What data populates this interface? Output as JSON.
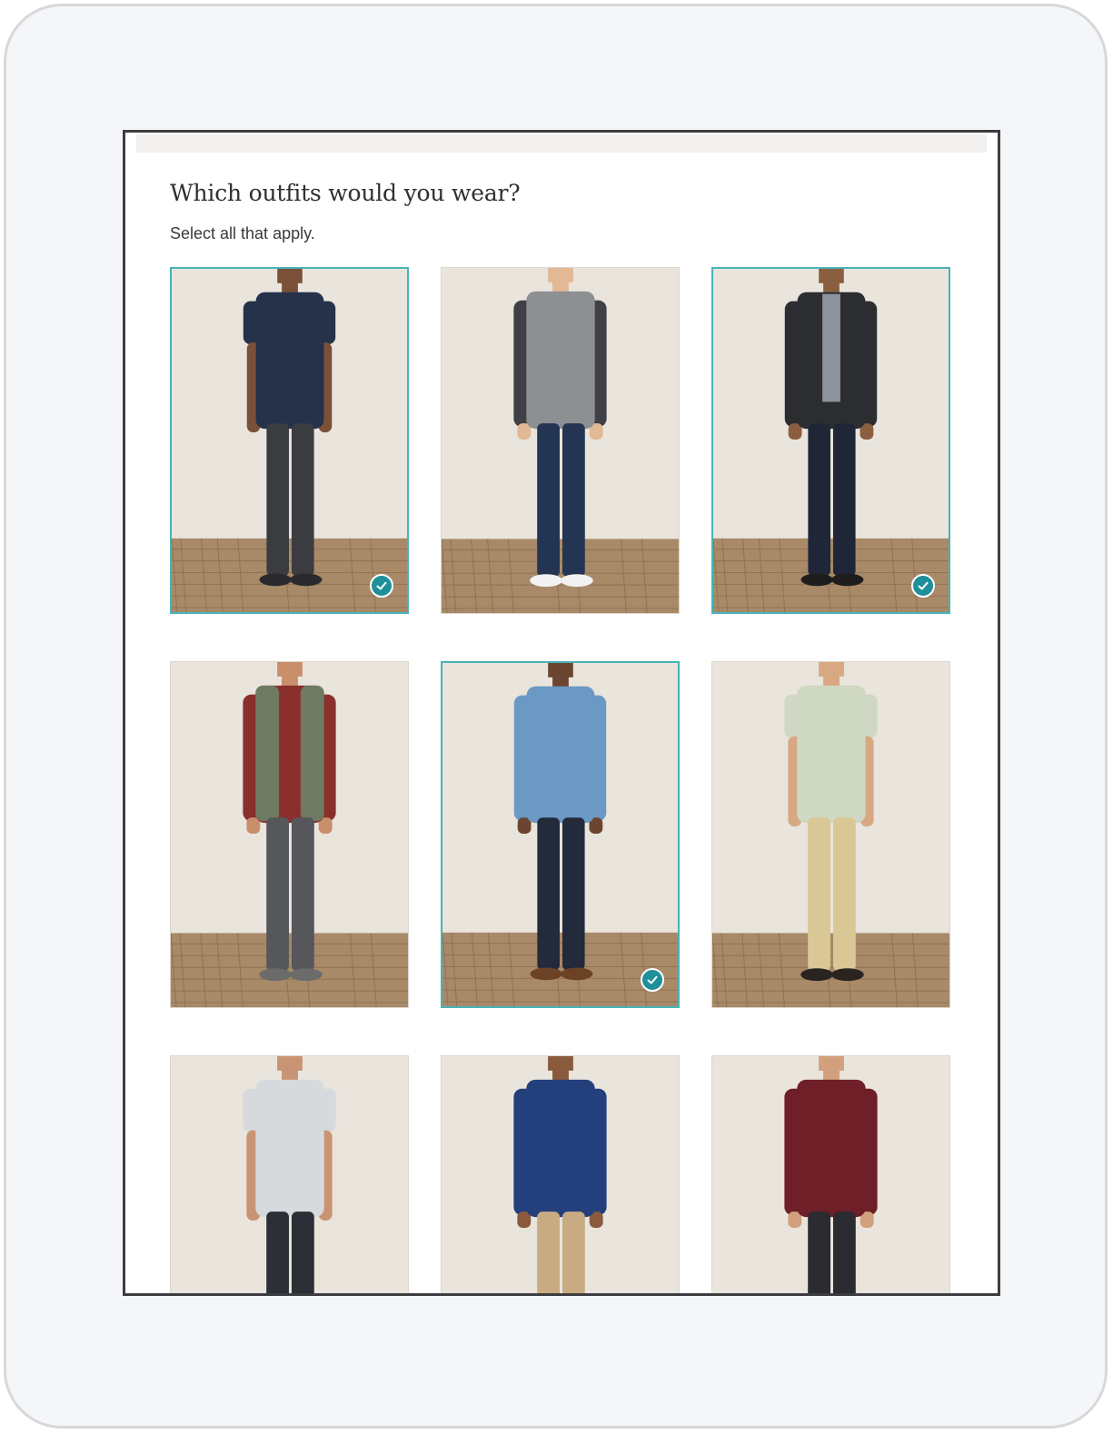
{
  "question": {
    "title": "Which outfits would you wear?",
    "subtitle": "Select all that apply."
  },
  "colors": {
    "accent": "#1f8f9a",
    "selected_border": "#47b3b8",
    "backdrop": "#e9e4dc",
    "floor": "#a88a68"
  },
  "outfits": [
    {
      "id": "outfit-1",
      "selected": true,
      "skin": "#7a5138",
      "top": "#25324a",
      "sleeves": "short",
      "bottom": "#3a3c40",
      "shoe": "#2a2a2e"
    },
    {
      "id": "outfit-2",
      "selected": false,
      "skin": "#e2b895",
      "top": "#8d8f92",
      "sleeves": "long",
      "sleeve": "#3e4045",
      "bottom": "#243553",
      "shoe": "#f2f2f2"
    },
    {
      "id": "outfit-3",
      "selected": true,
      "skin": "#8b5e3f",
      "top": "#2b2d31",
      "sleeves": "long",
      "inner": "#8e949b",
      "bottom": "#1f2638",
      "shoe": "#1d1d1d"
    },
    {
      "id": "outfit-4",
      "selected": false,
      "skin": "#c98f6b",
      "top": "#8a2f2c",
      "sleeves": "long",
      "vest": "#6f7a62",
      "bottom": "#55575b",
      "shoe": "#6b6b6b"
    },
    {
      "id": "outfit-5",
      "selected": true,
      "skin": "#6b4530",
      "top": "#6c98c4",
      "sleeves": "long",
      "bottom": "#222a3b",
      "shoe": "#6b4226"
    },
    {
      "id": "outfit-6",
      "selected": false,
      "skin": "#d8a882",
      "top": "#cfd8c2",
      "sleeves": "short",
      "bottom": "#d9c796",
      "shoe": "#2a2420"
    },
    {
      "id": "outfit-7",
      "selected": false,
      "skin": "#c99474",
      "top": "#d6dadd",
      "sleeves": "short",
      "bottom": "#2c2f35",
      "shoe": "#2c2f35"
    },
    {
      "id": "outfit-8",
      "selected": false,
      "skin": "#8a5a3c",
      "top": "#233f7c",
      "sleeves": "long",
      "bottom": "#c8ab82",
      "shoe": "#c8ab82"
    },
    {
      "id": "outfit-9",
      "selected": false,
      "skin": "#d2a07c",
      "top": "#6f1f27",
      "sleeves": "long",
      "bottom": "#2a2c31",
      "shoe": "#2a2c31"
    }
  ]
}
